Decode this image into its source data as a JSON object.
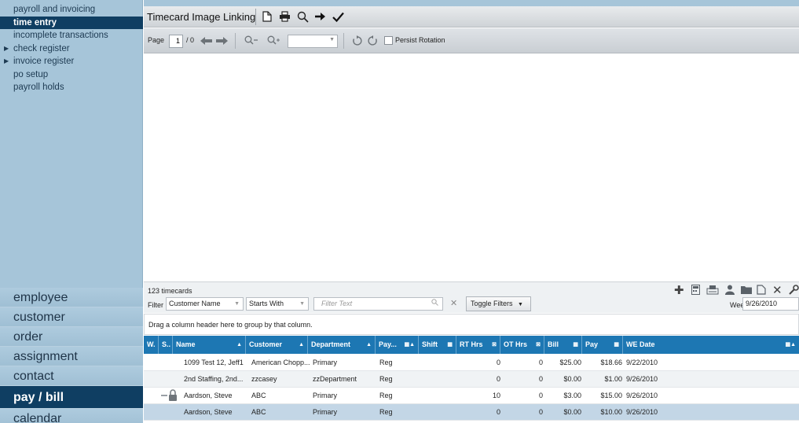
{
  "sidebar": {
    "sub_items": [
      {
        "label": "payroll and invoicing",
        "expandable": false,
        "active": false
      },
      {
        "label": "time entry",
        "expandable": false,
        "active": true
      },
      {
        "label": "incomplete transactions",
        "expandable": false,
        "active": false
      },
      {
        "label": "check register",
        "expandable": true,
        "active": false
      },
      {
        "label": "invoice register",
        "expandable": true,
        "active": false
      },
      {
        "label": "po setup",
        "expandable": false,
        "active": false
      },
      {
        "label": "payroll holds",
        "expandable": false,
        "active": false
      }
    ],
    "main_items": [
      {
        "label": "employee",
        "active": false
      },
      {
        "label": "customer",
        "active": false
      },
      {
        "label": "order",
        "active": false
      },
      {
        "label": "assignment",
        "active": false
      },
      {
        "label": "contact",
        "active": false
      },
      {
        "label": "pay / bill",
        "active": true
      },
      {
        "label": "calendar",
        "active": false
      }
    ]
  },
  "toolbar": {
    "title": "Timecard Image Linking",
    "icons": [
      "new-document-icon",
      "print-icon",
      "search-icon",
      "arrow-right-icon",
      "checkmark-icon"
    ]
  },
  "viewer_toolbar": {
    "page_label": "Page",
    "page_value": "1",
    "page_total": "/ 0",
    "zoom_value": "",
    "persist_rotation_label": "Persist Rotation",
    "persist_rotation_checked": false
  },
  "grid": {
    "count_label": "123  timecards",
    "filter_label": "Filter",
    "filter_field": "Customer Name",
    "filter_operator": "Starts With",
    "filter_placeholder": "Filter Text",
    "toggle_filters_label": "Toggle Filters",
    "week_label": "Week",
    "week_value": "9/26/2010",
    "group_hint": "Drag a column header here to group by that column.",
    "columns": [
      "W.",
      "S..",
      "Name",
      "Customer",
      "Department",
      "Pay...",
      "Shift",
      "RT Hrs",
      "OT Hrs",
      "Bill",
      "Pay",
      "WE Date"
    ],
    "rows": [
      {
        "locked": false,
        "name": "1099 Test 12, Jeff1",
        "customer": "American Chopp...",
        "department": "Primary",
        "pay_type": "Reg",
        "shift": "",
        "rt_hrs": "0",
        "ot_hrs": "0",
        "bill": "$25.00",
        "pay": "$18.66",
        "we_date": "9/22/2010"
      },
      {
        "locked": false,
        "name": "2nd Staffing, 2nd...",
        "customer": "zzcasey",
        "department": "zzDepartment",
        "pay_type": "Reg",
        "shift": "",
        "rt_hrs": "0",
        "ot_hrs": "0",
        "bill": "$0.00",
        "pay": "$1.00",
        "we_date": "9/26/2010"
      },
      {
        "locked": true,
        "name": "Aardson, Steve",
        "customer": "ABC",
        "department": "Primary",
        "pay_type": "Reg",
        "shift": "",
        "rt_hrs": "10",
        "ot_hrs": "0",
        "bill": "$3.00",
        "pay": "$15.00",
        "we_date": "9/26/2010"
      },
      {
        "locked": false,
        "name": "Aardson, Steve",
        "customer": "ABC",
        "department": "Primary",
        "pay_type": "Reg",
        "shift": "",
        "rt_hrs": "0",
        "ot_hrs": "0",
        "bill": "$0.00",
        "pay": "$10.00",
        "we_date": "9/26/2010"
      }
    ],
    "selected_row": 3
  },
  "colors": {
    "sidebar_bg": "#a6c5d9",
    "nav_active": "#0f3e62",
    "grid_header": "#1d77b3",
    "selected_row": "#c3d6e6"
  }
}
